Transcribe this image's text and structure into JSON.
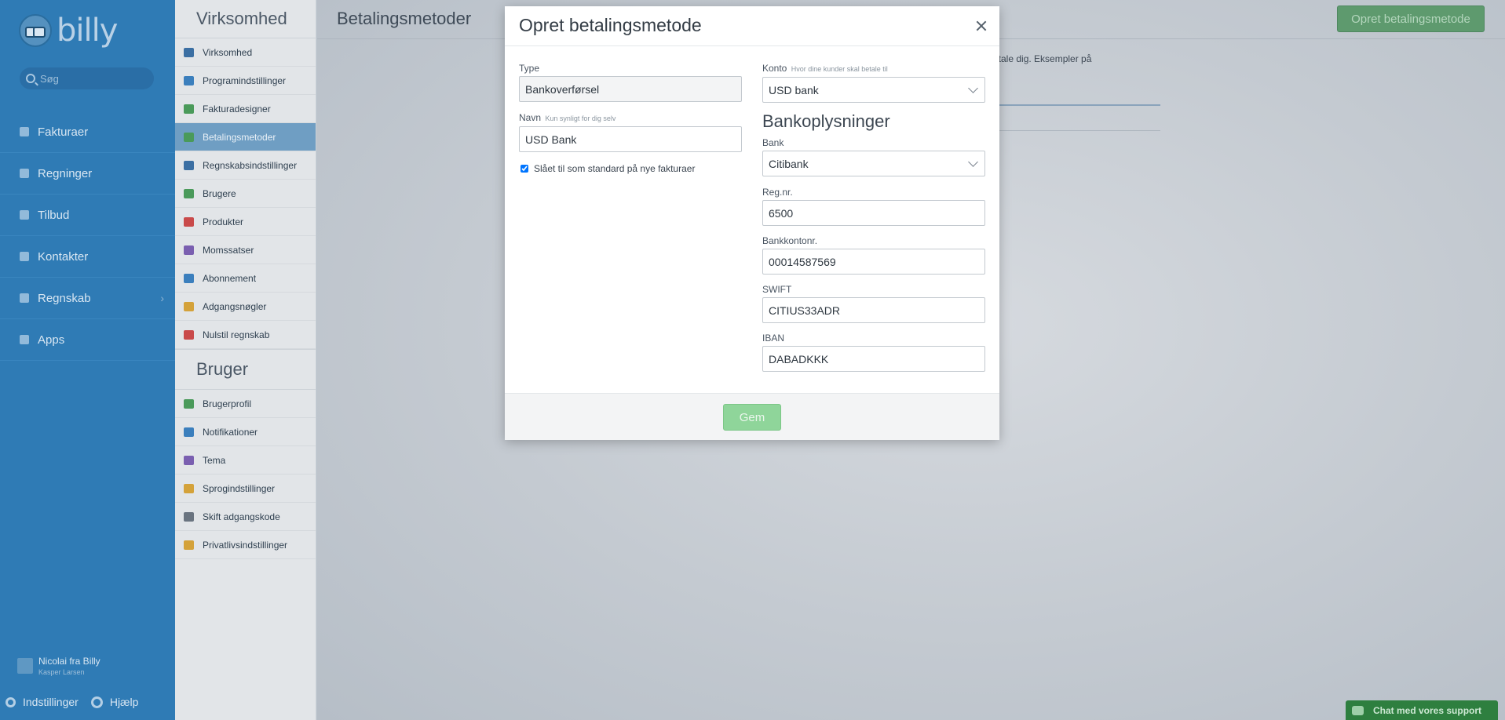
{
  "app": {
    "logo_text": "billy"
  },
  "search": {
    "placeholder": "Søg"
  },
  "nav": {
    "items": [
      {
        "label": "Fakturaer",
        "icon": "invoice-icon"
      },
      {
        "label": "Regninger",
        "icon": "bill-icon"
      },
      {
        "label": "Tilbud",
        "icon": "offer-icon"
      },
      {
        "label": "Kontakter",
        "icon": "contacts-icon"
      },
      {
        "label": "Regnskab",
        "icon": "accounting-icon",
        "chevron": "›"
      },
      {
        "label": "Apps",
        "icon": "apps-icon"
      }
    ]
  },
  "user": {
    "name": "Nicolai fra Billy",
    "sub": "Kasper Larsen"
  },
  "footer_links": {
    "settings": "Indstillinger",
    "help": "Hjælp"
  },
  "settings": {
    "section1_title": "Virksomhed",
    "section1_items": [
      {
        "label": "Virksomhed",
        "color": "#3b6fa3"
      },
      {
        "label": "Programindstillinger",
        "color": "#3b7fbd"
      },
      {
        "label": "Fakturadesigner",
        "color": "#4a9a5a"
      },
      {
        "label": "Betalingsmetoder",
        "color": "#4a9a5a",
        "active": true
      },
      {
        "label": "Regnskabsindstillinger",
        "color": "#3b6fa3"
      },
      {
        "label": "Brugere",
        "color": "#4a9a5a"
      },
      {
        "label": "Produkter",
        "color": "#c94a4a"
      },
      {
        "label": "Momssatser",
        "color": "#7a5fb0"
      },
      {
        "label": "Abonnement",
        "color": "#3b7fbd"
      },
      {
        "label": "Adgangsnøgler",
        "color": "#d4a23a"
      },
      {
        "label": "Nulstil regnskab",
        "color": "#c94a4a"
      }
    ],
    "section2_title": "Bruger",
    "section2_items": [
      {
        "label": "Brugerprofil",
        "color": "#4a9a5a"
      },
      {
        "label": "Notifikationer",
        "color": "#3b7fbd"
      },
      {
        "label": "Tema",
        "color": "#7a5fb0"
      },
      {
        "label": "Sprogindstillinger",
        "color": "#d4a23a"
      },
      {
        "label": "Skift adgangskode",
        "color": "#6a7480"
      },
      {
        "label": "Privatlivsindstillinger",
        "color": "#d4a23a"
      }
    ]
  },
  "page": {
    "title": "Betalingsmetoder",
    "create_button": "Opret betalingsmetode",
    "background_text": "etale dig. Eksempler på"
  },
  "modal": {
    "title": "Opret betalingsmetode",
    "type_label": "Type",
    "type_value": "Bankoverførsel",
    "name_label": "Navn",
    "name_hint": "Kun synligt for dig selv",
    "name_value": "USD Bank",
    "default_checkbox_label": "Slået til som standard på nye fakturaer",
    "account_label": "Konto",
    "account_hint": "Hvor dine kunder skal betale til",
    "account_value": "USD bank",
    "bank_section_title": "Bankoplysninger",
    "bank_label": "Bank",
    "bank_value": "Citibank",
    "reg_label": "Reg.nr.",
    "reg_value": "6500",
    "account_no_label": "Bankkontonr.",
    "account_no_value": "00014587569",
    "swift_label": "SWIFT",
    "swift_value": "CITIUS33ADR",
    "iban_label": "IBAN",
    "iban_value": "DABADKKK",
    "save_label": "Gem"
  },
  "chat": {
    "label": "Chat med vores support"
  }
}
